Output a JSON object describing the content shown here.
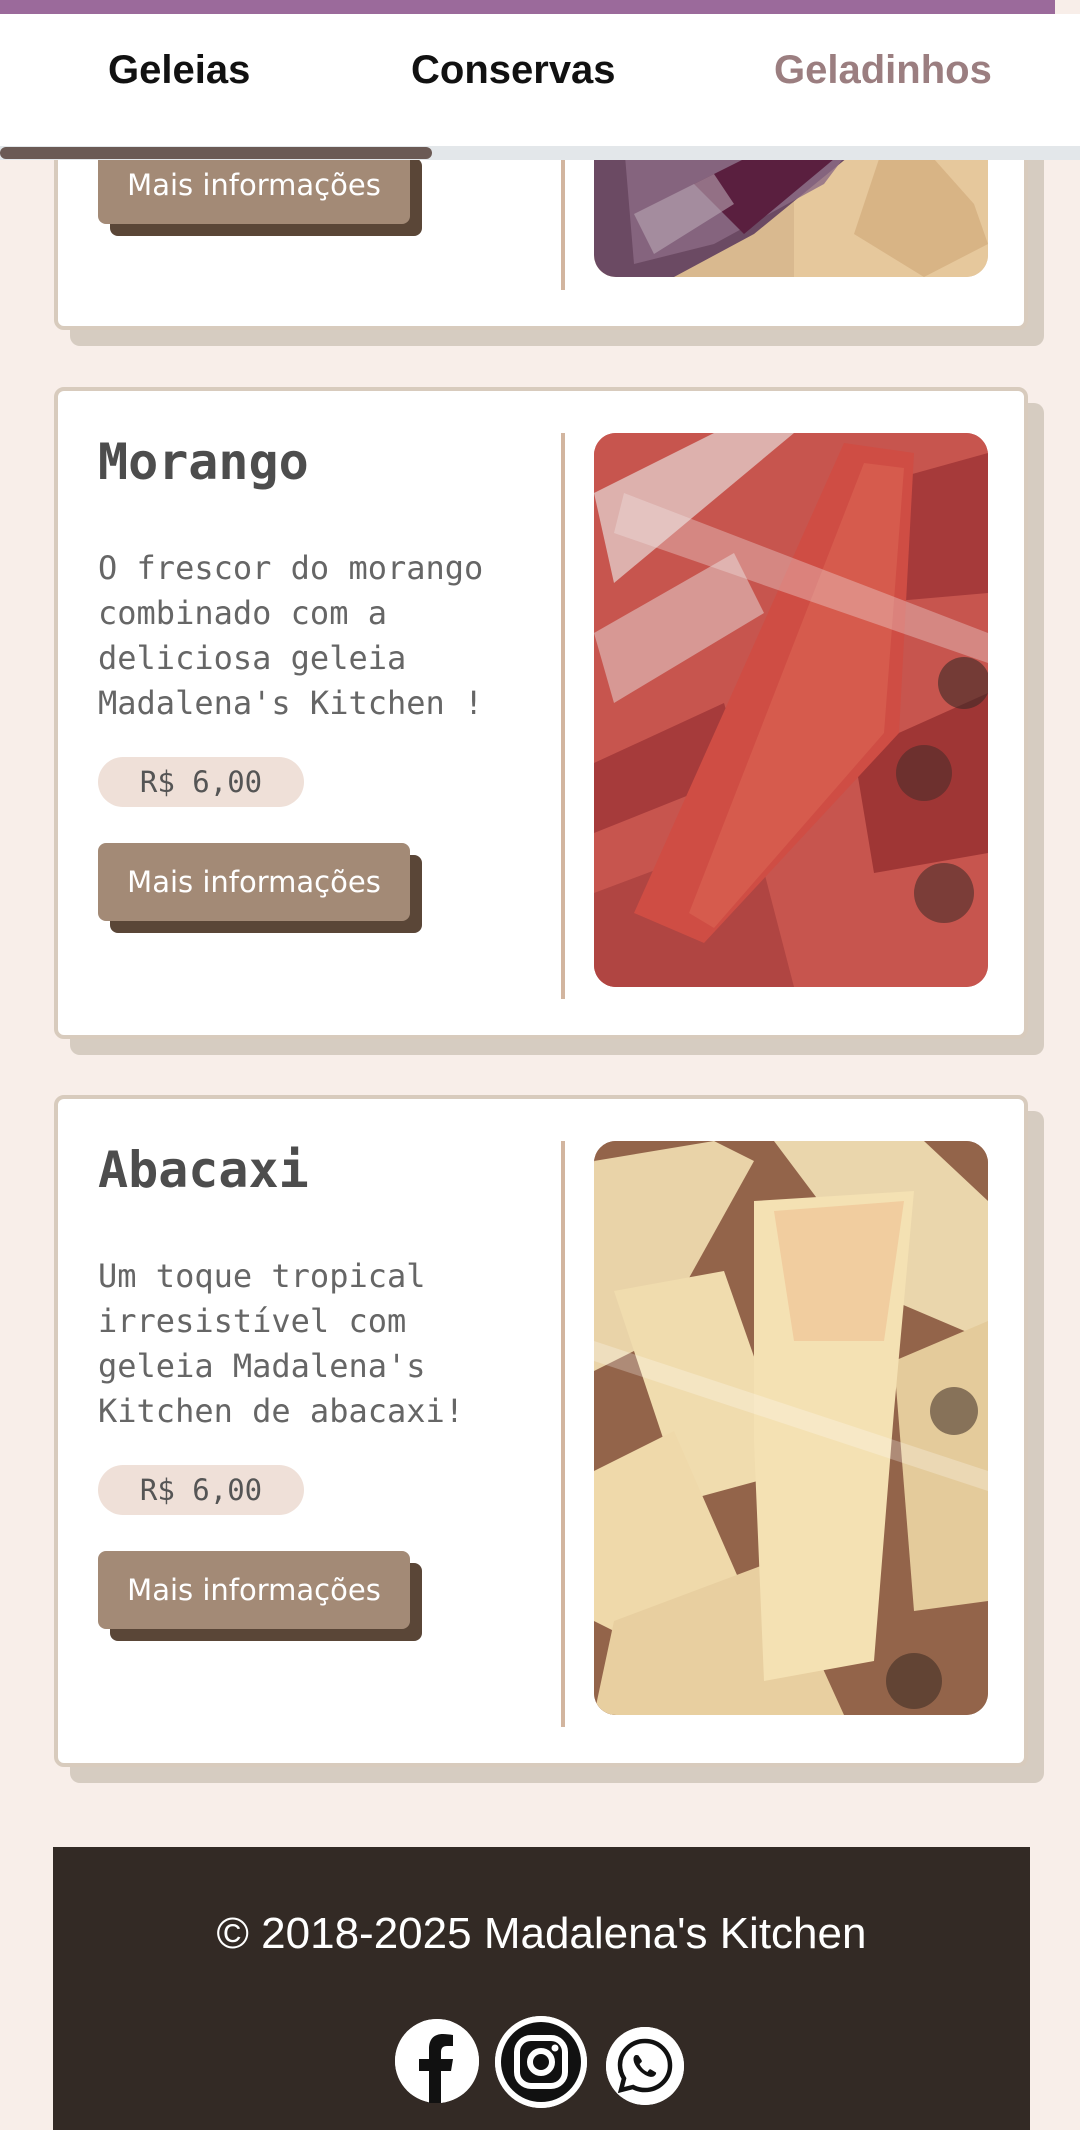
{
  "nav": {
    "tabs": [
      {
        "label": "Geleias",
        "active": false
      },
      {
        "label": "Conservas",
        "active": false
      },
      {
        "label": "Geladinhos",
        "active": true
      }
    ]
  },
  "products": [
    {
      "title": "",
      "description": "",
      "price": "",
      "button_label": "Mais informações",
      "image": "grape-popsicle-photo"
    },
    {
      "title": "Morango",
      "description": "O frescor do morango\ncombinado com a\ndeliciosa geleia\nMadalena's Kitchen !",
      "price": "R$ 6,00",
      "button_label": "Mais informações",
      "image": "strawberry-popsicle-photo"
    },
    {
      "title": "Abacaxi",
      "description": "Um toque tropical\nirresistível com\ngeleia Madalena's\nKitchen de abacaxi!",
      "price": "R$ 6,00",
      "button_label": "Mais informações",
      "image": "pineapple-popsicle-photo"
    }
  ],
  "footer": {
    "copyright": "© 2018-2025 Madalena's Kitchen",
    "social": [
      "facebook-icon",
      "instagram-icon",
      "whatsapp-icon"
    ]
  },
  "colors": {
    "accent_bar": "#9b6a9b",
    "active_tab": "#9b7e80",
    "button": "#a38a76",
    "button_shadow": "#5a4637",
    "footer_bg": "#332a25",
    "page_bg": "#f8eee9"
  }
}
